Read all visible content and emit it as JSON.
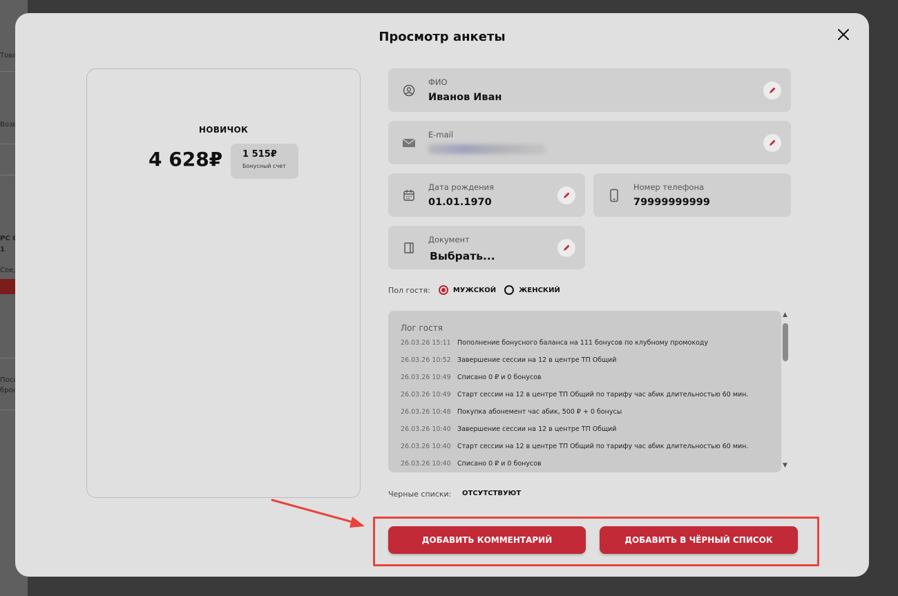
{
  "background": {
    "rows": [
      "Това",
      "Возв",
      "РС С",
      "1",
      "Сое,",
      "Поса",
      "брон"
    ]
  },
  "modal": {
    "title": "Просмотр анкеты"
  },
  "loyalty": {
    "level": "НОВИЧОК",
    "balance": "4 628₽",
    "bonus_value": "1 515₽",
    "bonus_label": "Бонусный счет"
  },
  "fields": {
    "fio": {
      "label": "ФИО",
      "value": "Иванов Иван",
      "icon": "user-circle-icon"
    },
    "email": {
      "label": "E-mail",
      "value": "",
      "icon": "envelope-icon"
    },
    "birthdate": {
      "label": "Дата рождения",
      "value": "01.01.1970",
      "icon": "calendar-icon"
    },
    "phone": {
      "label": "Номер телефона",
      "value": "79999999999",
      "icon": "phone-icon"
    },
    "document": {
      "label": "Документ",
      "value": "Выбрать...",
      "icon": "document-icon"
    }
  },
  "gender": {
    "label": "Пол гостя:",
    "options": [
      {
        "label": "МУЖСКОЙ",
        "checked": true
      },
      {
        "label": "ЖЕНСКИЙ",
        "checked": false
      }
    ]
  },
  "log": {
    "title": "Лог гостя",
    "entries": [
      {
        "date": "26.03.26 15:11",
        "text": "Пополнение бонусного баланса на 111 бонусов по клубному промокоду"
      },
      {
        "date": "26.03.26 10:52",
        "text": "Завершение сессии на 12 в центре ТП Общий"
      },
      {
        "date": "26.03.26 10:49",
        "text": "Списано 0 ₽ и 0 бонусов"
      },
      {
        "date": "26.03.26 10:49",
        "text": "Старт сессии на 12 в центре ТП Общий по тарифу час абик длительностью 60 мин."
      },
      {
        "date": "26.03.26 10:48",
        "text": "Покупка абонемент час абик, 500 ₽ + 0 бонусы"
      },
      {
        "date": "26.03.26 10:40",
        "text": "Завершение сессии на 12 в центре ТП Общий"
      },
      {
        "date": "26.03.26 10:40",
        "text": "Старт сессии на 12 в центре ТП Общий по тарифу час абик длительностью 60 мин."
      },
      {
        "date": "26.03.26 10:40",
        "text": "Списано 0 ₽ и 0 бонусов"
      }
    ]
  },
  "blacklists": {
    "label": "Черные списки:",
    "value": "ОТСУТСТВУЮТ"
  },
  "buttons": {
    "add_comment": "ДОБАВИТЬ КОММЕНТАРИЙ",
    "add_blacklist": "ДОБАВИТЬ В ЧЁРНЫЙ СПИСОК"
  },
  "colors": {
    "accent": "#c22a38",
    "annotation": "#e8433a"
  }
}
